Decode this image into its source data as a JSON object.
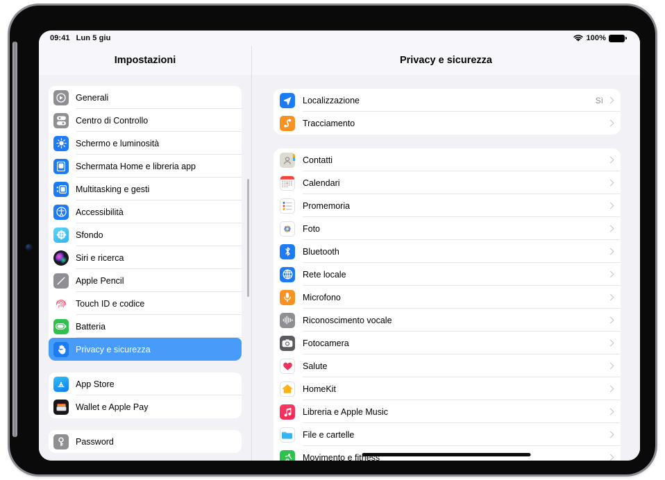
{
  "status_bar": {
    "time": "09:41",
    "date": "Lun 5 giu",
    "battery_percent": "100%",
    "wifi_icon": "wifi-icon",
    "battery_icon": "battery-icon"
  },
  "sidebar": {
    "title": "Impostazioni",
    "groups": [
      {
        "items": [
          {
            "label": "Generali",
            "icon": "gear-general-icon",
            "selected": false
          },
          {
            "label": "Centro di Controllo",
            "icon": "control-center-icon",
            "selected": false
          },
          {
            "label": "Schermo e luminosità",
            "icon": "brightness-icon",
            "selected": false
          },
          {
            "label": "Schermata Home e libreria app",
            "icon": "home-screen-icon",
            "selected": false
          },
          {
            "label": "Multitasking e gesti",
            "icon": "multitasking-icon",
            "selected": false
          },
          {
            "label": "Accessibilità",
            "icon": "accessibility-icon",
            "selected": false
          },
          {
            "label": "Sfondo",
            "icon": "wallpaper-icon",
            "selected": false
          },
          {
            "label": "Siri e ricerca",
            "icon": "siri-icon",
            "selected": false
          },
          {
            "label": "Apple Pencil",
            "icon": "apple-pencil-icon",
            "selected": false
          },
          {
            "label": "Touch ID e codice",
            "icon": "touch-id-icon",
            "selected": false
          },
          {
            "label": "Batteria",
            "icon": "battery-settings-icon",
            "selected": false
          },
          {
            "label": "Privacy e sicurezza",
            "icon": "privacy-hand-icon",
            "selected": true
          }
        ]
      },
      {
        "items": [
          {
            "label": "App Store",
            "icon": "app-store-icon",
            "selected": false
          },
          {
            "label": "Wallet e Apple Pay",
            "icon": "wallet-icon",
            "selected": false
          }
        ]
      },
      {
        "items": [
          {
            "label": "Password",
            "icon": "password-key-icon",
            "selected": false
          }
        ]
      }
    ]
  },
  "detail": {
    "title": "Privacy e sicurezza",
    "groups": [
      {
        "name": "location-group",
        "rows": [
          {
            "label": "Localizzazione",
            "icon": "location-arrow-icon",
            "value": "Sì"
          },
          {
            "label": "Tracciamento",
            "icon": "tracking-icon",
            "value": ""
          }
        ]
      },
      {
        "name": "permissions-group",
        "rows": [
          {
            "label": "Contatti",
            "icon": "contacts-icon",
            "value": ""
          },
          {
            "label": "Calendari",
            "icon": "calendar-icon",
            "value": ""
          },
          {
            "label": "Promemoria",
            "icon": "reminders-icon",
            "value": ""
          },
          {
            "label": "Foto",
            "icon": "photos-icon",
            "value": ""
          },
          {
            "label": "Bluetooth",
            "icon": "bluetooth-icon",
            "value": ""
          },
          {
            "label": "Rete locale",
            "icon": "local-network-icon",
            "value": ""
          },
          {
            "label": "Microfono",
            "icon": "microphone-icon",
            "value": ""
          },
          {
            "label": "Riconoscimento vocale",
            "icon": "speech-icon",
            "value": ""
          },
          {
            "label": "Fotocamera",
            "icon": "camera-icon",
            "value": ""
          },
          {
            "label": "Salute",
            "icon": "health-icon",
            "value": ""
          },
          {
            "label": "HomeKit",
            "icon": "homekit-icon",
            "value": ""
          },
          {
            "label": "Libreria e Apple Music",
            "icon": "apple-music-icon",
            "value": ""
          },
          {
            "label": "File e cartelle",
            "icon": "files-icon",
            "value": ""
          },
          {
            "label": "Movimento e fitness",
            "icon": "fitness-icon",
            "value": ""
          }
        ]
      }
    ]
  },
  "colors": {
    "accent_selected": "#479cf9",
    "background": "#f2f1f6",
    "card": "#ffffff"
  }
}
